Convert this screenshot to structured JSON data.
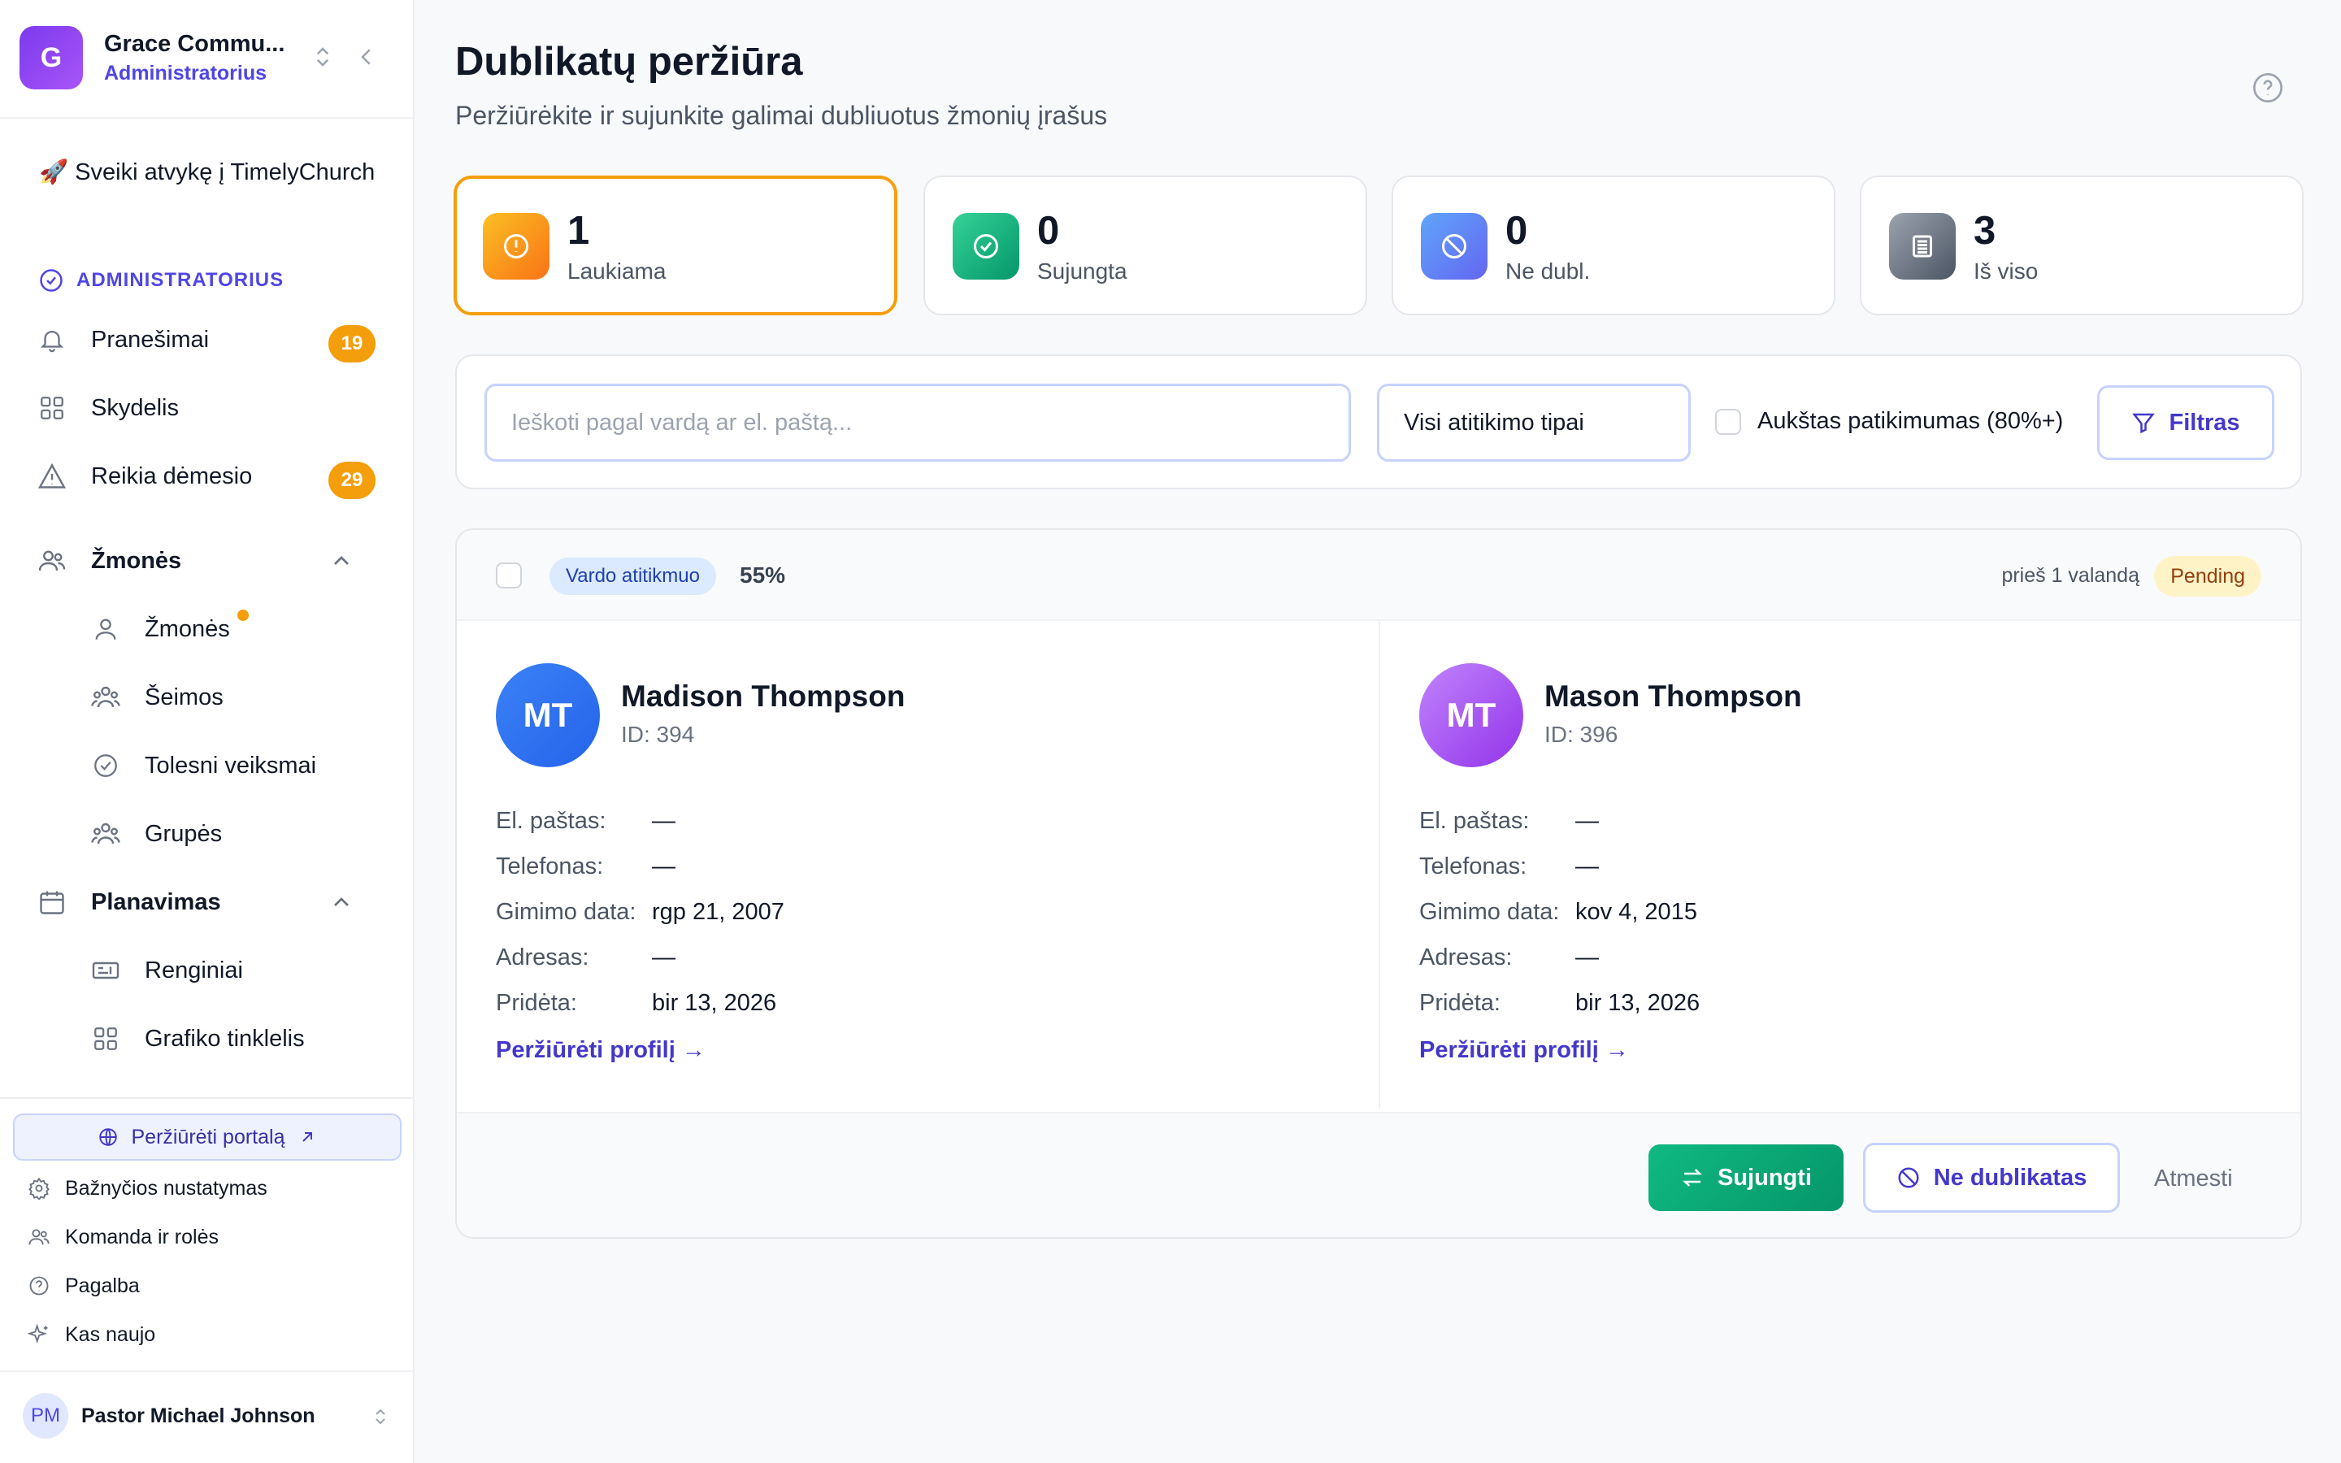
{
  "sidebar": {
    "org_initial": "G",
    "org_name": "Grace Commu...",
    "org_role": "Administratorius",
    "welcome": "🚀 Sveiki atvykę į TimelyChurch",
    "section_label": "ADMINISTRATORIUS",
    "items": [
      {
        "label": "Pranešimai",
        "badge": "19",
        "icon": "bell-icon"
      },
      {
        "label": "Skydelis",
        "icon": "grid-icon"
      },
      {
        "label": "Reikia dėmesio",
        "badge": "29",
        "icon": "warning-icon"
      },
      {
        "label": "Žmonės",
        "icon": "users-icon"
      },
      {
        "label": "Žmonės",
        "icon": "user-icon"
      },
      {
        "label": "Šeimos",
        "icon": "family-icon"
      },
      {
        "label": "Tolesni veiksmai",
        "icon": "check-circle-icon"
      },
      {
        "label": "Grupės",
        "icon": "groups-icon"
      },
      {
        "label": "Planavimas",
        "icon": "calendar-icon"
      },
      {
        "label": "Renginiai",
        "icon": "ticket-icon"
      },
      {
        "label": "Grafiko tinklelis",
        "icon": "grid-icon"
      }
    ],
    "portal_label": "Peržiūrėti portalą",
    "links": [
      {
        "label": "Bažnyčios nustatymas",
        "icon": "gear-icon"
      },
      {
        "label": "Komanda ir rolės",
        "icon": "team-icon"
      },
      {
        "label": "Pagalba",
        "icon": "help-icon"
      },
      {
        "label": "Kas naujo",
        "icon": "sparkle-icon"
      }
    ],
    "user_initials": "PM",
    "user_name": "Pastor Michael Johnson"
  },
  "header": {
    "title": "Dublikatų peržiūra",
    "subtitle": "Peržiūrėkite ir sujunkite galimai dubliuotus žmonių įrašus"
  },
  "stats": [
    {
      "value": "1",
      "label": "Laukiama",
      "icon": "alert-icon",
      "color": "#f59e0b"
    },
    {
      "value": "0",
      "label": "Sujungta",
      "icon": "check-icon",
      "color": "#10b981"
    },
    {
      "value": "0",
      "label": "Ne dubl.",
      "icon": "ban-icon",
      "color": "#6366f1"
    },
    {
      "value": "3",
      "label": "Iš viso",
      "icon": "list-icon",
      "color": "#6b7280"
    }
  ],
  "filters": {
    "search_placeholder": "Ieškoti pagal vardą ar el. paštą...",
    "match_type": "Visi atitikimo tipai",
    "high_confidence": "Aukštas patikimumas (80%+)",
    "filter_button": "Filtras"
  },
  "duplicate": {
    "match_type": "Vardo atitikmuo",
    "score": "55%",
    "time_ago": "prieš 1 valandą",
    "status": "Pending",
    "field_labels": {
      "email": "El. paštas:",
      "phone": "Telefonas:",
      "birth": "Gimimo data:",
      "address": "Adresas:",
      "added": "Pridėta:"
    },
    "people": [
      {
        "initials": "MT",
        "name": "Madison Thompson",
        "id": "ID: 394",
        "email": "—",
        "phone": "—",
        "birth": "rgp 21, 2007",
        "address": "—",
        "added": "bir 13, 2026",
        "link": "Peržiūrėti profilį →",
        "color": "#2563eb"
      },
      {
        "initials": "MT",
        "name": "Mason Thompson",
        "id": "ID: 396",
        "email": "—",
        "phone": "—",
        "birth": "kov 4, 2015",
        "address": "—",
        "added": "bir 13, 2026",
        "link": "Peržiūrėti profilį →",
        "color": "#a855f7"
      }
    ],
    "actions": {
      "merge": "Sujungti",
      "not_duplicate": "Ne dublikatas",
      "dismiss": "Atmesti"
    }
  }
}
